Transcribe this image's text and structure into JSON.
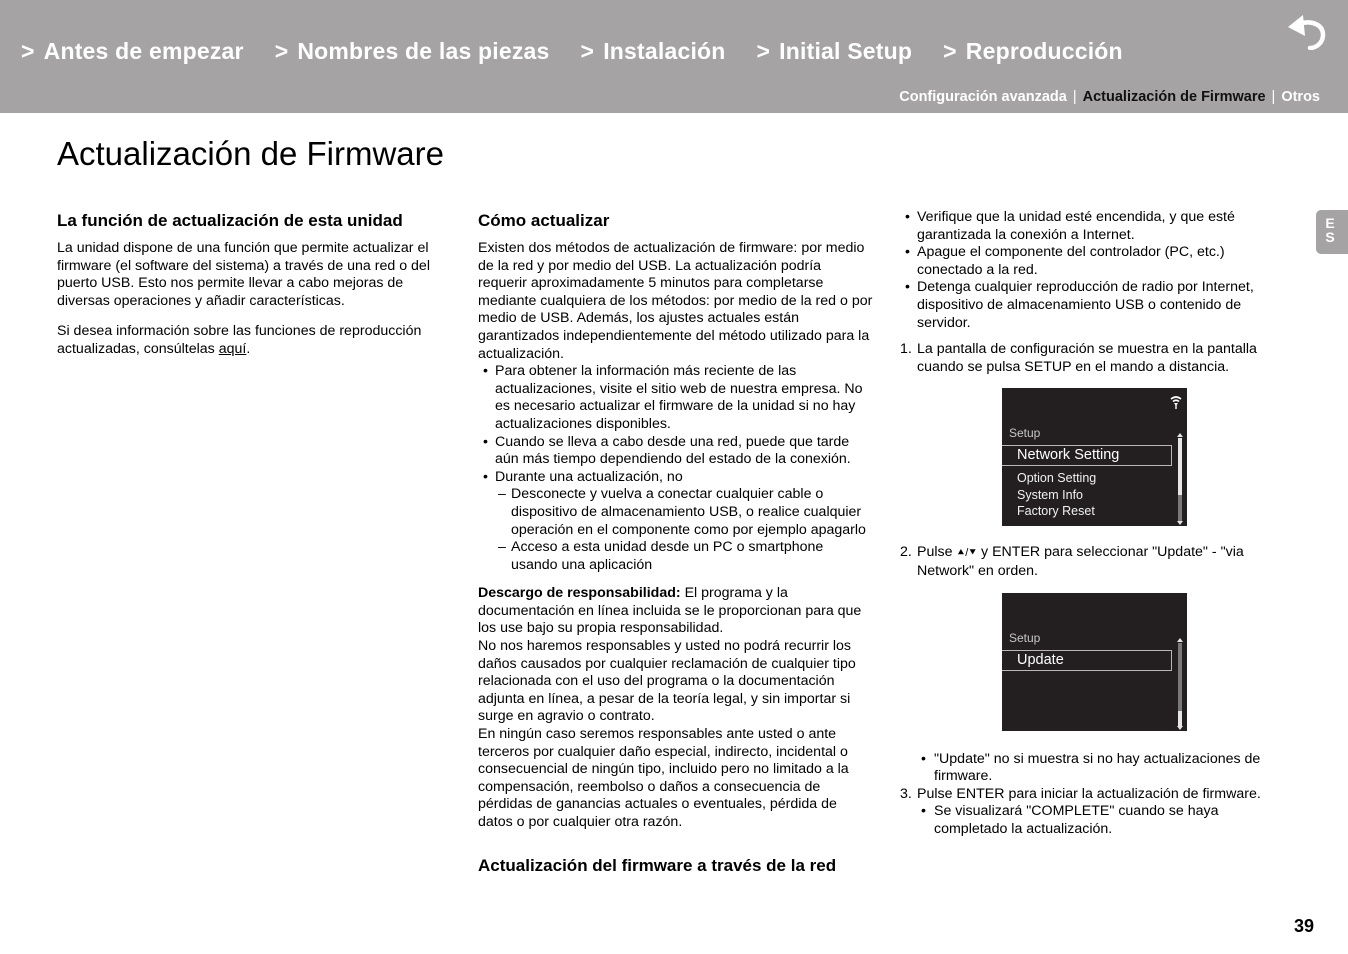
{
  "header": {
    "nav": [
      {
        "prefix": ">",
        "label": "Antes de empezar"
      },
      {
        "prefix": ">",
        "label": "Nombres de las piezas"
      },
      {
        "prefix": ">",
        "label": "Instalación"
      },
      {
        "prefix": ">",
        "label": "Initial Setup"
      },
      {
        "prefix": ">",
        "label": "Reproducción"
      }
    ],
    "back_icon": "return-arrow-icon",
    "subnav": [
      {
        "label": "Configuración avanzada",
        "active": false
      },
      {
        "label": "Actualización de Firmware",
        "active": true
      },
      {
        "label": "Otros",
        "active": false
      }
    ],
    "subnav_separator": "|"
  },
  "page_title": "Actualización de Firmware",
  "col1": {
    "heading": "La función de actualización de esta unidad",
    "para1": "La unidad dispone de una función que permite actualizar el firmware (el software del sistema) a través de una red o del puerto USB. Esto nos permite llevar a cabo mejoras de diversas operaciones y añadir características.",
    "para2_before": "Si desea información sobre las funciones de reproducción actualizadas, consúltelas ",
    "para2_link": "aquí",
    "para2_after": "."
  },
  "col2": {
    "heading": "Cómo actualizar",
    "intro": "Existen dos métodos de actualización de firmware: por medio de la red y por medio del USB. La actualización podría requerir aproximadamente 5 minutos para completarse mediante cualquiera de los métodos: por medio de la red o por medio de USB. Además, los ajustes actuales están garantizados independientemente del método utilizado para la actualización.",
    "bullets": [
      "Para obtener la información más reciente de las actualizaciones, visite el sitio web de nuestra empresa. No es necesario actualizar el firmware de la unidad si no hay actualizaciones disponibles.",
      "Cuando se lleva a cabo desde una red, puede que tarde aún más tiempo dependiendo del estado de la conexión.",
      "Durante una actualización, no"
    ],
    "dashes": [
      "Desconecte y vuelva a conectar cualquier cable o dispositivo de almacenamiento USB, o realice cualquier operación en el componente como por ejemplo apagarlo",
      "Acceso a esta unidad desde un PC o smartphone usando una aplicación"
    ],
    "disclaimer_label": "Descargo de responsabilidad:",
    "disclaimer_1": " El programa y la documentación en línea incluida se le proporcionan para que los use bajo su propia responsabilidad.",
    "disclaimer_2": "No nos haremos responsables y usted no podrá recurrir los daños causados por cualquier reclamación de cualquier tipo relacionada con el uso del programa o la documentación adjunta en línea, a pesar de la teoría legal, y sin importar si surge en agravio o contrato.",
    "disclaimer_3": "En ningún caso seremos responsables ante usted o ante terceros por cualquier daño especial, indirecto, incidental o consecuencial de ningún tipo, incluido pero no limitado a la compensación, reembolso o daños a consecuencia de pérdidas de ganancias actuales o eventuales, pérdida de datos o por cualquier otra razón.",
    "heading2": "Actualización del firmware a través de la red"
  },
  "col3": {
    "bullets": [
      "Verifique que la unidad esté encendida, y que esté garantizada la conexión a Internet.",
      "Apague el componente del controlador (PC, etc.) conectado a la red.",
      "Detenga cualquier reproducción de radio por Internet, dispositivo de almacenamiento USB o contenido de servidor."
    ],
    "steps": [
      {
        "n": "1.",
        "text": "La pantalla de configuración se muestra en la pantalla cuando se pulsa SETUP en el mando a distancia."
      },
      {
        "n": "2.",
        "text": "Pulse ♠/♦ y ENTER para seleccionar \"Update\" - \"via Network\" en orden."
      },
      {
        "n": "3.",
        "text": "Pulse ENTER para iniciar la actualización de firmware."
      }
    ],
    "step2_arrows": "⯅/⯆",
    "step2_before": "Pulse ",
    "step2_after": " y ENTER para seleccionar \"Update\" - \"via Network\" en orden.",
    "step2_note": "\"Update\" no si muestra si no hay actualizaciones de firmware.",
    "step3_note": "Se visualizará \"COMPLETE\" cuando se haya completado la actualización."
  },
  "screen1": {
    "title": "Setup",
    "selected": "Network Setting",
    "items": [
      "Option Setting",
      "System Info",
      "Factory Reset"
    ],
    "status_icon": "network-icon"
  },
  "screen2": {
    "title": "Setup",
    "selected": "Update"
  },
  "lang_tab": {
    "line1": "E",
    "line2": "S"
  },
  "page_number": "39",
  "colors": {
    "header_bg": "#a5a3a4",
    "screen_bg": "#231f20"
  }
}
